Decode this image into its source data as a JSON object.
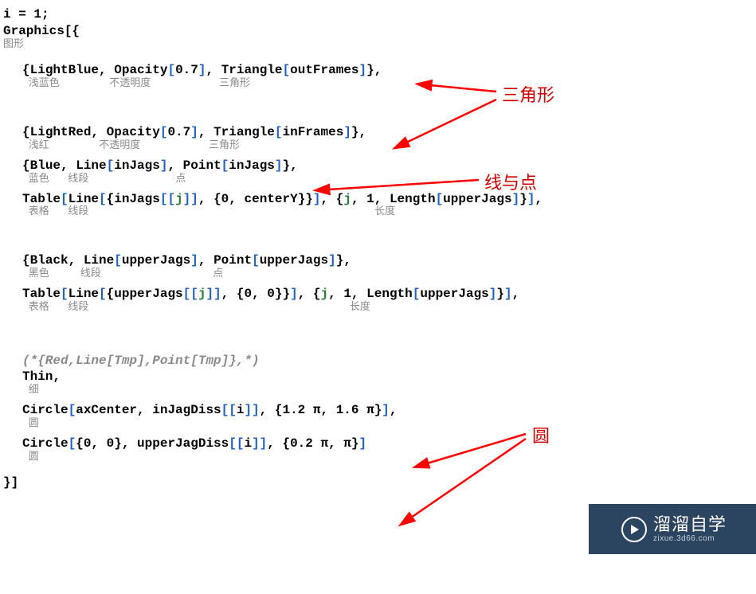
{
  "code": {
    "l1": "i = 1;",
    "l2": "Graphics[{",
    "h2": "图形",
    "b1": {
      "pre": "{",
      "sym1": "LightBlue",
      "sep1": ", ",
      "sym2": "Opacity",
      "br2o": "[",
      "arg2": "0.7",
      "br2c": "]",
      "sep2": ", ",
      "sym3": "Triangle",
      "br3o": "[",
      "arg3": "outFrames",
      "br3c": "]",
      "post": "},"
    },
    "h_b1": " 浅蓝色        不透明度           三角形",
    "b2": {
      "pre": "{",
      "sym1": "LightRed",
      "sep1": ", ",
      "sym2": "Opacity",
      "br2o": "[",
      "arg2": "0.7",
      "br2c": "]",
      "sep2": ", ",
      "sym3": "Triangle",
      "br3o": "[",
      "arg3": "inFrames",
      "br3c": "]",
      "post": "},"
    },
    "h_b2": " 浅红        不透明度           三角形",
    "b3": {
      "pre": "{",
      "sym1": "Blue",
      "sep1": ", ",
      "sym2": "Line",
      "br2o": "[",
      "arg2": "inJags",
      "br2c": "]",
      "sep2": ", ",
      "sym3": "Point",
      "br3o": "[",
      "arg3": "inJags",
      "br3c": "]",
      "post": "},"
    },
    "h_b3": " 蓝色   线段              点",
    "t1": {
      "p1": "Table",
      "b1o": "[",
      "p2": "Line",
      "b2o": "[",
      "p3": "{inJags",
      "b3o": "[[",
      "idx": "j",
      "b3c": "]]",
      "p4": ", {0, centerY}}",
      "b2c": "]",
      "p5": ", {",
      "idx2": "j",
      "p6": ", 1, ",
      "p7": "Length",
      "b4o": "[",
      "arg": "upperJags",
      "b4c": "]",
      "p8": "}",
      "b1c": "]",
      "post": ","
    },
    "h_t1": " 表格   线段                                              长度",
    "b4": {
      "pre": "{",
      "sym1": "Black",
      "sep1": ", ",
      "sym2": "Line",
      "br2o": "[",
      "arg2": "upperJags",
      "br2c": "]",
      "sep2": ", ",
      "sym3": "Point",
      "br3o": "[",
      "arg3": "upperJags",
      "br3c": "]",
      "post": "},"
    },
    "h_b4": " 黑色     线段                  点",
    "t2": {
      "p1": "Table",
      "b1o": "[",
      "p2": "Line",
      "b2o": "[",
      "p3": "{upperJags",
      "b3o": "[[",
      "idx": "j",
      "b3c": "]]",
      "p4": ", {0, 0}}",
      "b2c": "]",
      "p5": ", {",
      "idx2": "j",
      "p6": ", 1, ",
      "p7": "Length",
      "b4o": "[",
      "arg": "upperJags",
      "b4c": "]",
      "p8": "}",
      "b1c": "]",
      "post": ","
    },
    "h_t2": " 表格   线段                                          长度",
    "comment": "(*{Red,Line[Tmp],Point[Tmp]},*)",
    "thin": "Thin,",
    "h_thin": " 细",
    "c1": {
      "p1": "Circle",
      "b1o": "[",
      "arg1": "axCenter, inJagDiss",
      "b2o": "[[",
      "idx": "i",
      "b2c": "]]",
      "arg2": ", {1.2 π, 1.6 π}",
      "b1c": "]",
      "post": ","
    },
    "h_c1": " 圆",
    "c2": {
      "p1": "Circle",
      "b1o": "[",
      "arg1": "{0, 0}, upperJagDiss",
      "b2o": "[[",
      "idx": "i",
      "b2c": "]]",
      "arg2": ", {0.2 π, π}",
      "b1c": "]"
    },
    "h_c2": " 圆",
    "close": "}]"
  },
  "annotations": {
    "triangle": "三角形",
    "line_point": "线与点",
    "circle": "圆"
  },
  "watermark": {
    "title": "溜溜自学",
    "url": "zixue.3d66.com"
  }
}
